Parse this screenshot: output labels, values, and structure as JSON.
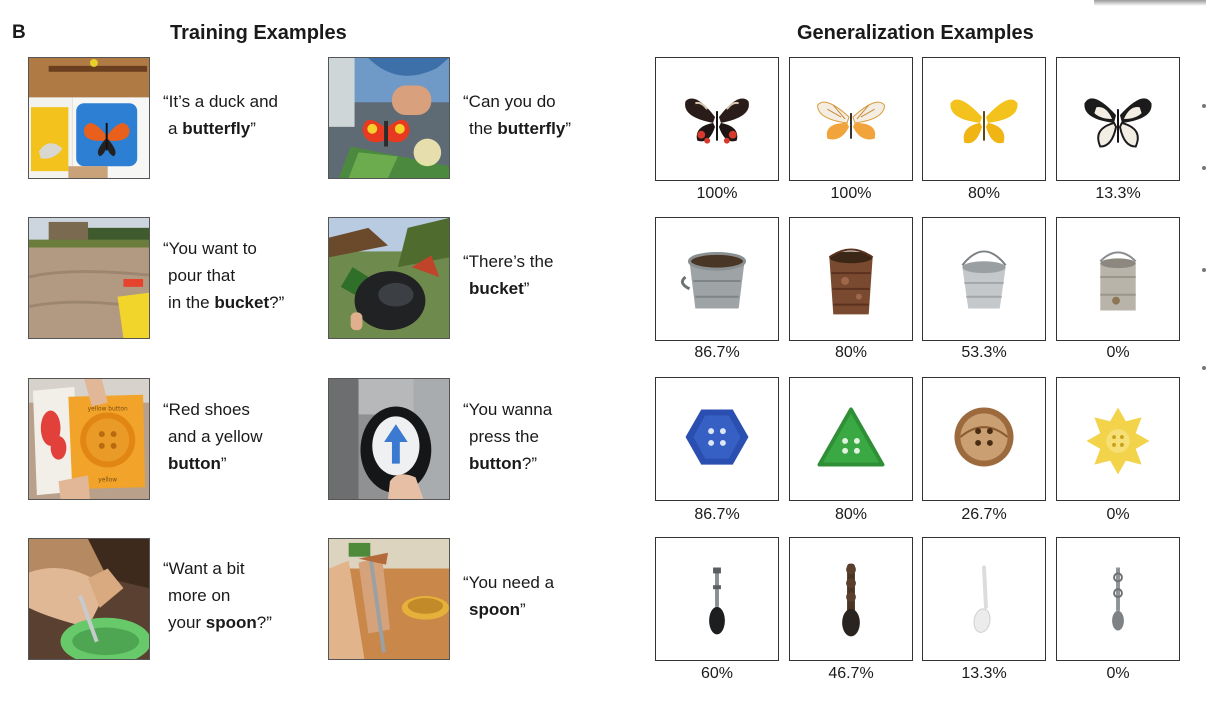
{
  "panel_label": "B",
  "training_heading": "Training Examples",
  "generalization_heading": "Generalization Examples",
  "training_examples": [
    {
      "lines": [
        [
          "“It’s a duck and",
          ""
        ],
        [
          "a ",
          "butterfly",
          "”"
        ]
      ]
    },
    {
      "lines": [
        [
          "“Can you do",
          ""
        ],
        [
          "the ",
          "butterfly",
          "”"
        ]
      ]
    },
    {
      "lines": [
        [
          "“You want to",
          ""
        ],
        [
          "pour that",
          ""
        ],
        [
          "in the ",
          "bucket",
          "?”"
        ]
      ]
    },
    {
      "lines": [
        [
          "“There’s the",
          ""
        ],
        [
          "",
          "bucket",
          "”"
        ]
      ]
    },
    {
      "lines": [
        [
          "“Red shoes",
          ""
        ],
        [
          "and a yellow",
          ""
        ],
        [
          "",
          "button",
          "”"
        ]
      ]
    },
    {
      "lines": [
        [
          "“You wanna",
          ""
        ],
        [
          "press the",
          ""
        ],
        [
          "",
          "button",
          "?”"
        ]
      ]
    },
    {
      "lines": [
        [
          "“Want a bit",
          ""
        ],
        [
          "more on",
          ""
        ],
        [
          "your ",
          "spoon",
          "?”"
        ]
      ]
    },
    {
      "lines": [
        [
          "“You need a",
          ""
        ],
        [
          "",
          "spoon",
          "”"
        ]
      ]
    }
  ],
  "photo_texts": {
    "book_button": "yellow button",
    "book_yellow": "yellow"
  },
  "generalization": {
    "rows": [
      {
        "object": "butterfly",
        "items": [
          {
            "icon": "butterfly-red-black-icon",
            "percent": "100%"
          },
          {
            "icon": "butterfly-orange-icon",
            "percent": "100%"
          },
          {
            "icon": "butterfly-yellow-icon",
            "percent": "80%"
          },
          {
            "icon": "butterfly-black-white-icon",
            "percent": "13.3%"
          }
        ]
      },
      {
        "object": "bucket",
        "items": [
          {
            "icon": "bucket-galvanized-wide-icon",
            "percent": "86.7%"
          },
          {
            "icon": "bucket-rusty-icon",
            "percent": "80%"
          },
          {
            "icon": "bucket-silver-icon",
            "percent": "53.3%"
          },
          {
            "icon": "bucket-tin-can-icon",
            "percent": "0%"
          }
        ]
      },
      {
        "object": "button",
        "items": [
          {
            "icon": "button-blue-hexagon-icon",
            "percent": "86.7%"
          },
          {
            "icon": "button-green-triangle-icon",
            "percent": "80%"
          },
          {
            "icon": "button-brown-round-icon",
            "percent": "26.7%"
          },
          {
            "icon": "button-yellow-star-icon",
            "percent": "0%"
          }
        ]
      },
      {
        "object": "spoon",
        "items": [
          {
            "icon": "spoon-dark-ornate-icon",
            "percent": "60%"
          },
          {
            "icon": "spoon-wooden-carved-icon",
            "percent": "46.7%"
          },
          {
            "icon": "spoon-white-plastic-icon",
            "percent": "13.3%"
          },
          {
            "icon": "spoon-silver-decorative-icon",
            "percent": "0%"
          }
        ]
      }
    ]
  }
}
